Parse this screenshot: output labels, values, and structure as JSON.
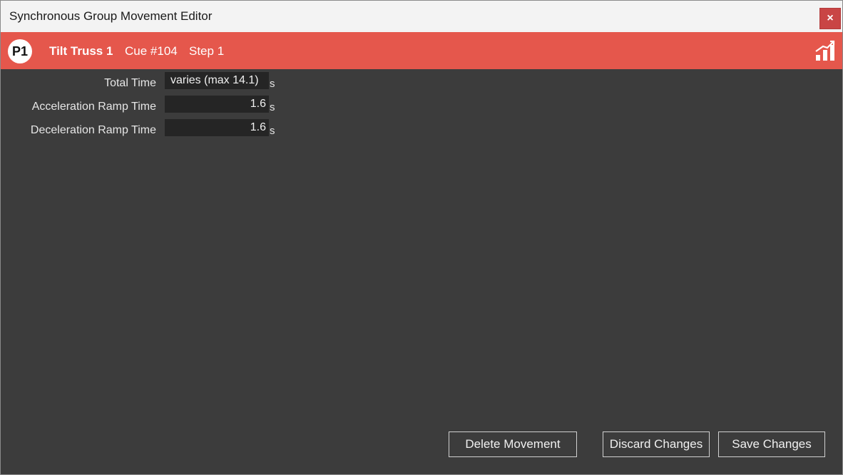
{
  "window": {
    "title": "Synchronous Group Movement Editor",
    "close_label": "×"
  },
  "header": {
    "badge": "P1",
    "name": "Tilt Truss 1",
    "cue": "Cue #104",
    "step": "Step 1",
    "icon": "bar-chart-icon",
    "accent_color": "#e5574c"
  },
  "fields": [
    {
      "label": "Total Time",
      "value": "varies (max 14.1)",
      "unit": "s"
    },
    {
      "label": "Acceleration Ramp Time",
      "value": "1.6",
      "unit": "s"
    },
    {
      "label": "Deceleration Ramp Time",
      "value": "1.6",
      "unit": "s"
    }
  ],
  "buttons": {
    "delete": "Delete Movement",
    "discard": "Discard Changes",
    "save": "Save Changes"
  }
}
